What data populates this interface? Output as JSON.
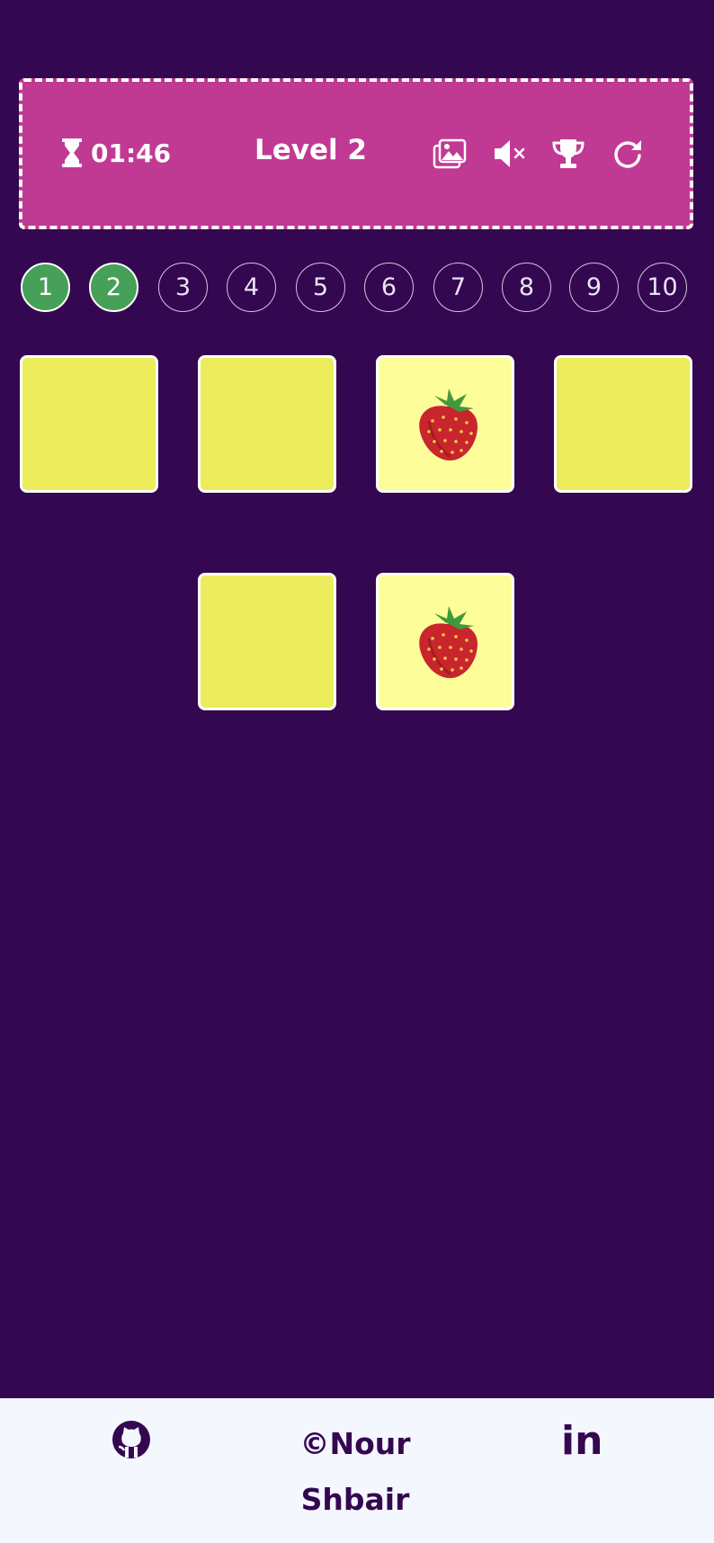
{
  "header": {
    "timer_icon": "hourglass-icon",
    "timer": "01:46",
    "level_title": "Level 2",
    "icons": [
      "image-icon",
      "mute-icon",
      "trophy-icon",
      "restart-icon"
    ]
  },
  "levels": {
    "items": [
      "1",
      "2",
      "3",
      "4",
      "5",
      "6",
      "7",
      "8",
      "9",
      "10"
    ],
    "completed": [
      "1",
      "2"
    ]
  },
  "board": {
    "cards": [
      {
        "state": "hidden",
        "content": ""
      },
      {
        "state": "hidden",
        "content": ""
      },
      {
        "state": "revealed",
        "content": "strawberry-icon"
      },
      {
        "state": "hidden",
        "content": ""
      },
      {
        "state": "hidden",
        "content": ""
      },
      {
        "state": "revealed",
        "content": "strawberry-icon"
      }
    ]
  },
  "footer": {
    "github_icon": "github-icon",
    "credit": "©Nour Shbair",
    "linkedin": "in"
  },
  "colors": {
    "background": "#340751",
    "header": "#c03a93",
    "card_hidden": "#ecec5c",
    "card_revealed": "#fdfd9a",
    "level_done": "#47a058",
    "footer": "#f5f7ff"
  }
}
